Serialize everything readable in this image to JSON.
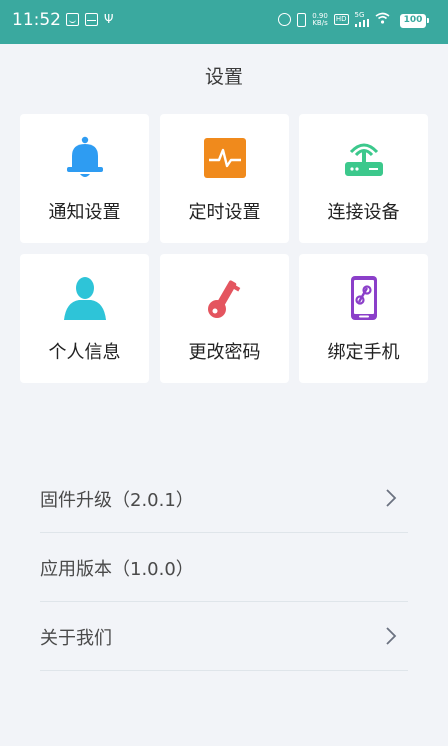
{
  "status_bar": {
    "time": "11:52",
    "net_speed_value": "0.90",
    "net_speed_unit": "KB/s",
    "hd_badge": "HD",
    "network": "5G",
    "battery": "100",
    "icons": [
      "face-icon",
      "mail-icon",
      "usb-icon",
      "alarm-icon",
      "vibrate-icon",
      "signal-icon",
      "wifi-icon",
      "battery-icon"
    ]
  },
  "header": {
    "title": "设置"
  },
  "grid": [
    {
      "label": "通知设置",
      "icon": "bell-icon",
      "color": "#2e9cf2"
    },
    {
      "label": "定时设置",
      "icon": "pulse-icon",
      "color": "#f08a1c"
    },
    {
      "label": "连接设备",
      "icon": "router-icon",
      "color": "#3cc88c"
    },
    {
      "label": "个人信息",
      "icon": "person-icon",
      "color": "#2ec4d8"
    },
    {
      "label": "更改密码",
      "icon": "key-icon",
      "color": "#e4555f"
    },
    {
      "label": "绑定手机",
      "icon": "phone-link-icon",
      "color": "#8b3fc9"
    }
  ],
  "list": [
    {
      "label": "固件升级（2.0.1）",
      "has_arrow": true
    },
    {
      "label": "应用版本（1.0.0）",
      "has_arrow": false
    },
    {
      "label": "关于我们",
      "has_arrow": true
    }
  ],
  "colors": {
    "status_bar": "#3aa99f",
    "background": "#f2f4f8",
    "card": "#ffffff"
  }
}
